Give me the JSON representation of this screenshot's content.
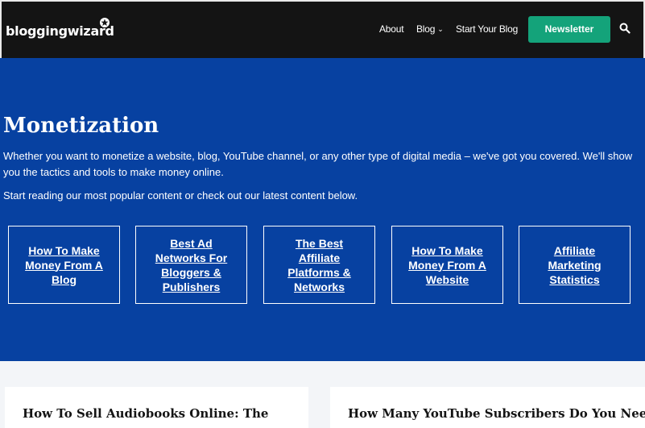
{
  "header": {
    "logo_text": "bloggingwizard",
    "nav": {
      "about": "About",
      "blog": "Blog",
      "start": "Start Your Blog",
      "newsletter": "Newsletter"
    }
  },
  "hero": {
    "title": "Monetization",
    "description": "Whether you want to monetize a website, blog, YouTube channel, or any other type of digital media – we've got you covered. We'll show you the tactics and tools to make money online.",
    "subtext": "Start reading our most popular content or check out our latest content below.",
    "cards": [
      {
        "label": "How To Make Money From A Blog"
      },
      {
        "label": "Best Ad Networks For Bloggers & Publishers"
      },
      {
        "label": "The Best Affiliate Platforms & Networks"
      },
      {
        "label": "How To Make Money From A Website"
      },
      {
        "label": "Affiliate Marketing Statistics"
      }
    ]
  },
  "posts": [
    {
      "title": "How To Sell Audiobooks Online: The"
    },
    {
      "title": "How Many YouTube Subscribers Do You Need"
    }
  ],
  "colors": {
    "header_bg": "#141414",
    "hero_bg": "#0741a1",
    "accent_green": "#14a37a"
  }
}
